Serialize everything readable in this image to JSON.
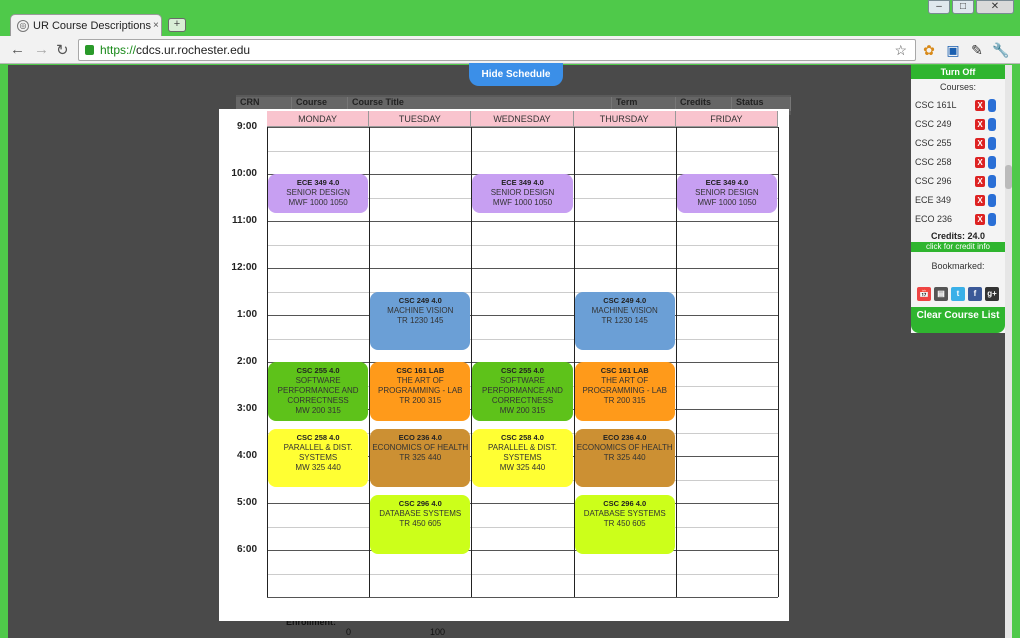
{
  "browser": {
    "tab_title": "UR Course Descriptions / C",
    "tab_close": "×",
    "new_tab": "+",
    "url_scheme": "https://",
    "url_host": "cdcs.ur.rochester.edu",
    "window_min": "–",
    "window_max": "□",
    "window_close": "✕"
  },
  "page": {
    "hide_schedule": "Hide Schedule",
    "behind_headers": [
      "CRN",
      "Course",
      "Course Title",
      "Term",
      "Credits",
      "Status"
    ],
    "bottom_label": "Enrollment:",
    "bottom_values": [
      "0",
      "100"
    ]
  },
  "schedule": {
    "days": [
      "MONDAY",
      "TUESDAY",
      "WEDNESDAY",
      "THURSDAY",
      "FRIDAY"
    ],
    "times": [
      "9:00",
      "10:00",
      "11:00",
      "12:00",
      "1:00",
      "2:00",
      "3:00",
      "4:00",
      "5:00",
      "6:00"
    ],
    "courses": [
      {
        "code": "ECE 349 4.0",
        "title": "SENIOR DESIGN",
        "meet": "MWF 1000 1050",
        "color": "#c79ff2",
        "days": [
          0,
          2,
          4
        ],
        "start": 10.0,
        "end": 10.83
      },
      {
        "code": "CSC 249 4.0",
        "title": "MACHINE VISION",
        "meet": "TR 1230 145",
        "color": "#6b9fd6",
        "days": [
          1,
          3
        ],
        "start": 12.5,
        "end": 13.75
      },
      {
        "code": "CSC 255 4.0",
        "title": "SOFTWARE PERFORMANCE AND CORRECTNESS",
        "meet": "MW 200 315",
        "color": "#5ec21a",
        "days": [
          0,
          2
        ],
        "start": 14.0,
        "end": 15.25
      },
      {
        "code": "CSC 161 LAB",
        "title": "THE ART OF PROGRAMMING - LAB",
        "meet": "TR 200 315",
        "color": "#ff9a1a",
        "days": [
          1,
          3
        ],
        "start": 14.0,
        "end": 15.25
      },
      {
        "code": "CSC 258 4.0",
        "title": "PARALLEL & DIST. SYSTEMS",
        "meet": "MW 325 440",
        "color": "#ffff33",
        "days": [
          0,
          2
        ],
        "start": 15.42,
        "end": 16.67
      },
      {
        "code": "ECO 236 4.0",
        "title": "ECONOMICS OF HEALTH",
        "meet": "TR 325 440",
        "color": "#cc9033",
        "days": [
          1,
          3
        ],
        "start": 15.42,
        "end": 16.67
      },
      {
        "code": "CSC 296 4.0",
        "title": "DATABASE SYSTEMS",
        "meet": "TR 450 605",
        "color": "#ccff1a",
        "days": [
          1,
          3
        ],
        "start": 16.83,
        "end": 18.08
      }
    ]
  },
  "sidebar": {
    "turn_off": "Turn Off",
    "courses_label": "Courses:",
    "courses": [
      "CSC 161L",
      "CSC 249",
      "CSC 255",
      "CSC 258",
      "CSC 296",
      "ECE 349",
      "ECO 236"
    ],
    "remove_glyph": "X",
    "credits": "Credits: 24.0",
    "credit_info": "click for credit info",
    "bookmarked_label": "Bookmarked:",
    "clear_list": "Clear Course List",
    "share_glyphs": [
      "📅",
      "▤",
      "t",
      "f",
      "g+"
    ]
  },
  "colors": {
    "chrome_green": "#4fc94a",
    "accent_green": "#2fb52f",
    "hide_blue": "#3b8fe8",
    "day_header_pink": "#f9c4ce"
  }
}
